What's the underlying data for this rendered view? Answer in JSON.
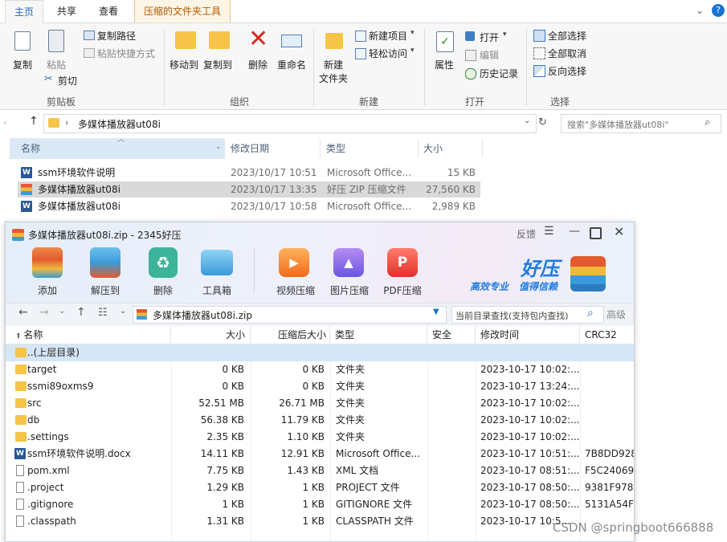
{
  "explorer": {
    "tabs": [
      "主页",
      "共享",
      "查看",
      "压缩的文件夹工具"
    ],
    "ribbon": {
      "clipboard": {
        "copy": "复制",
        "paste": "粘贴",
        "copy_path": "复制路径",
        "paste_shortcut": "粘贴快捷方式",
        "cut": "剪切",
        "group": "剪贴板"
      },
      "organize": {
        "move_to": "移动到",
        "copy_to": "复制到",
        "delete": "删除",
        "rename": "重命名",
        "group": "组织"
      },
      "new": {
        "new_folder_line1": "新建",
        "new_folder_line2": "文件夹",
        "new_item": "新建项目",
        "easy_access": "轻松访问",
        "group": "新建"
      },
      "open": {
        "properties": "属性",
        "open": "打开",
        "edit": "编辑",
        "history": "历史记录",
        "group": "打开"
      },
      "select": {
        "select_all": "全部选择",
        "select_none": "全部取消",
        "invert": "反向选择",
        "group": "选择"
      }
    },
    "address": "多媒体播放器ut08i",
    "search_placeholder": "搜索\"多媒体播放器ut08i\"",
    "columns": {
      "name": "名称",
      "modified": "修改日期",
      "type": "类型",
      "size": "大小"
    },
    "files": [
      {
        "name": "ssm环境软件说明",
        "modified": "2023/10/17 10:51",
        "type": "Microsoft Office...",
        "size": "15 KB",
        "icon": "word-doc-icon"
      },
      {
        "name": "多媒体播放器ut08i",
        "modified": "2023/10/17 13:35",
        "type": "好压 ZIP 压缩文件",
        "size": "27,560 KB",
        "icon": "zip-archive-icon"
      },
      {
        "name": "多媒体播放器ut08i",
        "modified": "2023/10/17 10:58",
        "type": "Microsoft Office...",
        "size": "2,989 KB",
        "icon": "word-doc-icon"
      }
    ]
  },
  "haozip": {
    "title": "多媒体播放器ut08i.zip - 2345好压",
    "feedback": "反馈",
    "toolbar": [
      "添加",
      "解压到",
      "删除",
      "工具箱",
      "视频压缩",
      "图片压缩",
      "PDF压缩"
    ],
    "brand": {
      "name": "好压",
      "slogan1": "高效专业",
      "slogan2": "值得信赖"
    },
    "path": "多媒体播放器ut08i.zip",
    "search_placeholder": "当前目录查找(支持包内查找)",
    "advanced": "高级",
    "columns": {
      "name": "名称",
      "size": "大小",
      "packed": "压缩后大小",
      "type": "类型",
      "security": "安全",
      "modified": "修改时间",
      "crc": "CRC32"
    },
    "rows": [
      {
        "name": "..(上层目录)",
        "size": "",
        "packed": "",
        "type": "",
        "modified": "",
        "crc": "",
        "kind": "folder"
      },
      {
        "name": "target",
        "size": "0 KB",
        "packed": "0 KB",
        "type": "文件夹",
        "modified": "2023-10-17 10:02:...",
        "crc": "",
        "kind": "folder"
      },
      {
        "name": "ssmi89oxms9",
        "size": "0 KB",
        "packed": "0 KB",
        "type": "文件夹",
        "modified": "2023-10-17 13:24:...",
        "crc": "",
        "kind": "folder"
      },
      {
        "name": "src",
        "size": "52.51 MB",
        "packed": "26.71 MB",
        "type": "文件夹",
        "modified": "2023-10-17 10:02:...",
        "crc": "",
        "kind": "folder"
      },
      {
        "name": "db",
        "size": "56.38 KB",
        "packed": "11.79 KB",
        "type": "文件夹",
        "modified": "2023-10-17 10:02:...",
        "crc": "",
        "kind": "folder"
      },
      {
        "name": ".settings",
        "size": "2.35 KB",
        "packed": "1.10 KB",
        "type": "文件夹",
        "modified": "2023-10-17 10:02:...",
        "crc": "",
        "kind": "folder"
      },
      {
        "name": "ssm环境软件说明.docx",
        "size": "14.11 KB",
        "packed": "12.91 KB",
        "type": "Microsoft Office...",
        "modified": "2023-10-17 10:51:...",
        "crc": "7B8DD928",
        "kind": "word"
      },
      {
        "name": "pom.xml",
        "size": "7.75 KB",
        "packed": "1.43 KB",
        "type": "XML 文档",
        "modified": "2023-10-17 08:51:...",
        "crc": "F5C24069",
        "kind": "file"
      },
      {
        "name": ".project",
        "size": "1.29 KB",
        "packed": "1 KB",
        "type": "PROJECT 文件",
        "modified": "2023-10-17 08:50:...",
        "crc": "9381F978",
        "kind": "file"
      },
      {
        "name": ".gitignore",
        "size": "1 KB",
        "packed": "1 KB",
        "type": "GITIGNORE 文件",
        "modified": "2023-10-17 08:50:...",
        "crc": "5131A54F",
        "kind": "file"
      },
      {
        "name": ".classpath",
        "size": "1.31 KB",
        "packed": "1 KB",
        "type": "CLASSPATH 文件",
        "modified": "2023-10-17 10:5...",
        "crc": "",
        "kind": "file"
      }
    ]
  },
  "watermark": "CSDN @springboot666888"
}
